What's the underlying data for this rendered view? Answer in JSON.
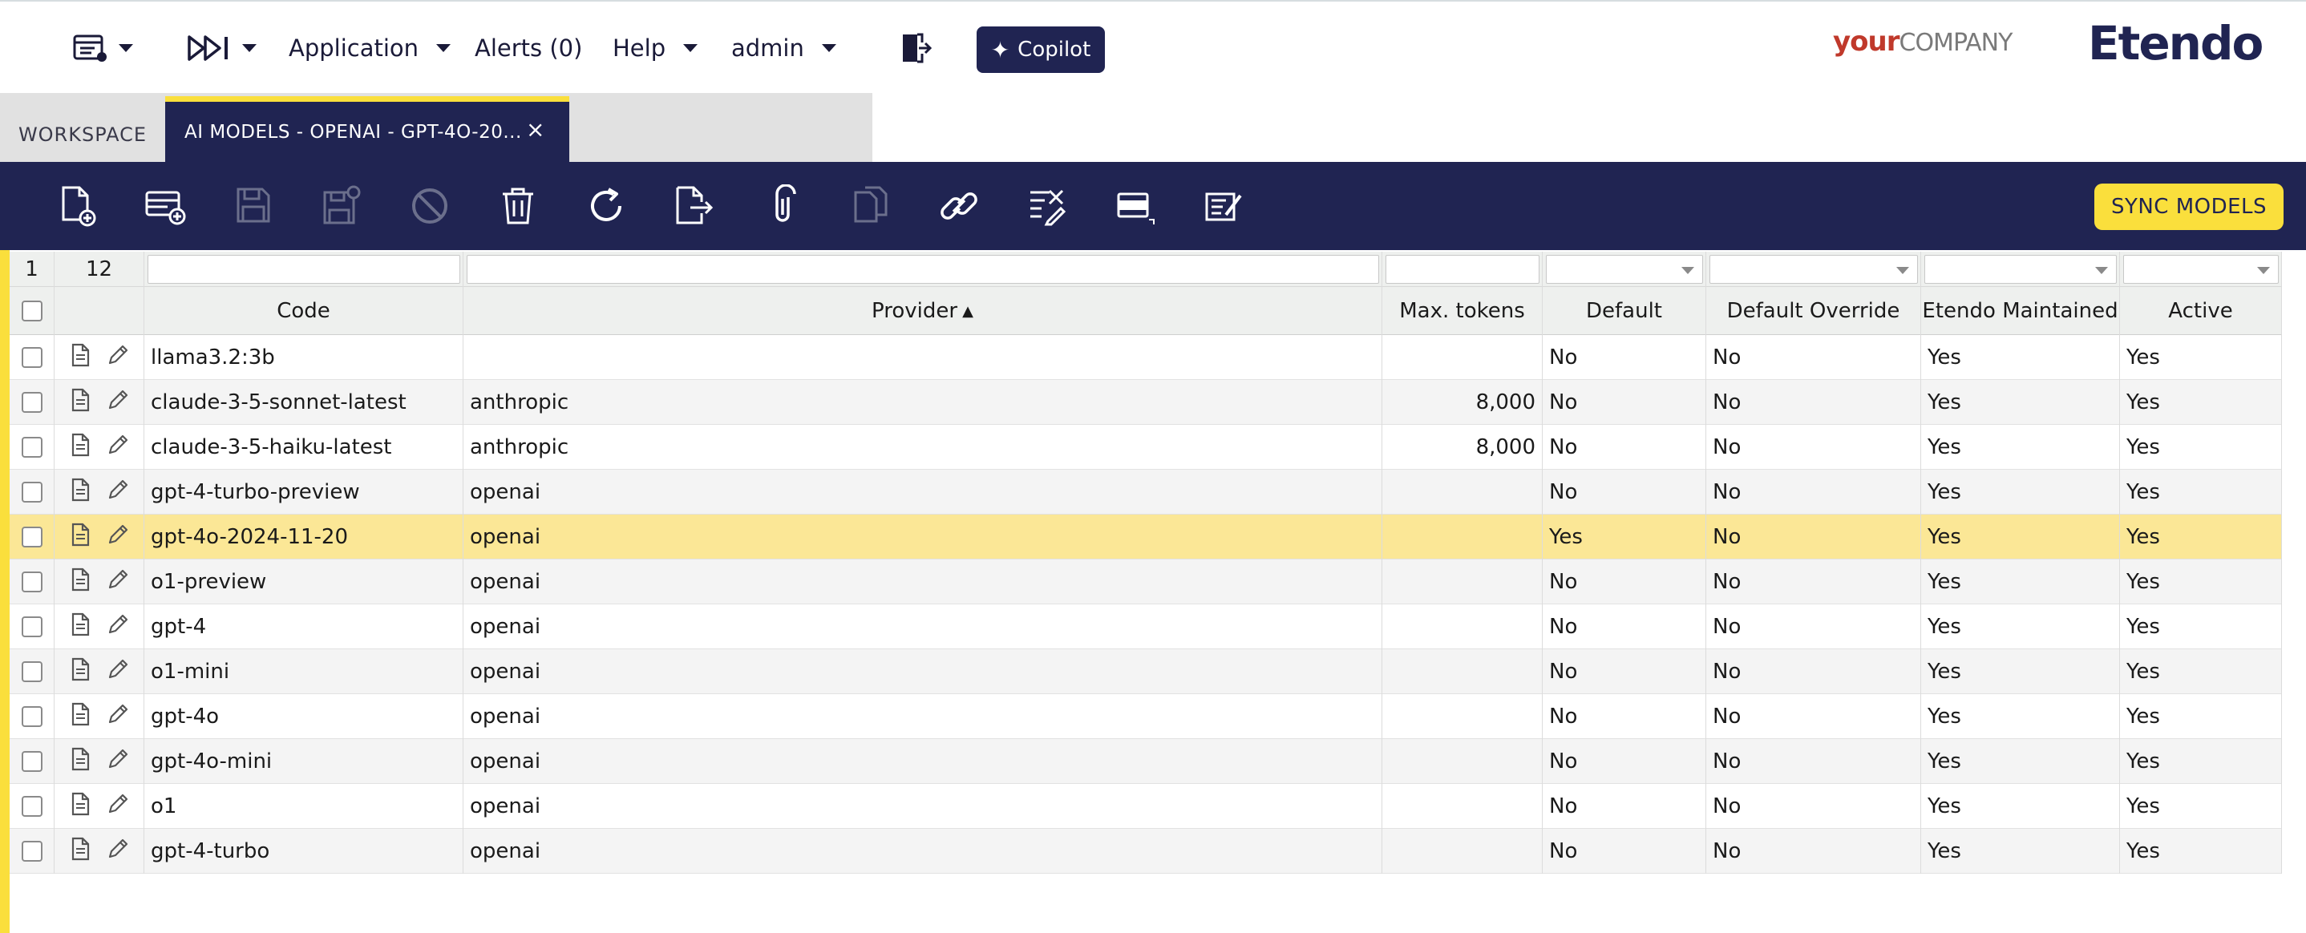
{
  "topbar": {
    "menus": [
      {
        "name": "application",
        "label": "Application"
      },
      {
        "name": "alerts",
        "label": "Alerts (0)"
      },
      {
        "name": "help",
        "label": "Help"
      },
      {
        "name": "user",
        "label": "admin"
      }
    ],
    "copilot_label": "Copilot",
    "company_logo": {
      "your": "your",
      "company": "COMPANY"
    },
    "brand_logo": "Etendo",
    "icons": [
      "form-menu-icon",
      "quick-launch-icon",
      "logout-icon",
      "copilot-sparkle-icon"
    ]
  },
  "tabs": {
    "workspace_label": "WORKSPACE",
    "active_label": "AI MODELS - OPENAI - GPT-4O-20...",
    "close_glyph": "×"
  },
  "toolbar": {
    "icons": [
      {
        "name": "new-document-icon",
        "enabled": true
      },
      {
        "name": "new-row-icon",
        "enabled": true
      },
      {
        "name": "save-icon",
        "enabled": false
      },
      {
        "name": "save-close-icon",
        "enabled": false
      },
      {
        "name": "undo-icon",
        "enabled": false
      },
      {
        "name": "delete-icon",
        "enabled": true
      },
      {
        "name": "refresh-icon",
        "enabled": true
      },
      {
        "name": "export-icon",
        "enabled": true
      },
      {
        "name": "attachment-icon",
        "enabled": true
      },
      {
        "name": "clone-icon",
        "enabled": false
      },
      {
        "name": "link-icon",
        "enabled": true
      },
      {
        "name": "audit-icon",
        "enabled": true
      },
      {
        "name": "grid-view-icon",
        "enabled": true
      },
      {
        "name": "process-icon",
        "enabled": true
      }
    ],
    "sync_label": "SYNC MODELS",
    "accent": "#fadf3c",
    "bar_color": "#202452"
  },
  "grid": {
    "selected_count": "1",
    "total_count": "12",
    "sort_indicator": "▲",
    "columns": [
      "Code",
      "Provider",
      "Max. tokens",
      "Default",
      "Default Override",
      "Etendo Maintained",
      "Active"
    ],
    "rows": [
      {
        "code": "llama3.2:3b",
        "provider": "",
        "max_tokens": "",
        "default": "No",
        "default_override": "No",
        "etendo_maintained": "Yes",
        "active": "Yes"
      },
      {
        "code": "claude-3-5-sonnet-latest",
        "provider": "anthropic",
        "max_tokens": "8,000",
        "default": "No",
        "default_override": "No",
        "etendo_maintained": "Yes",
        "active": "Yes"
      },
      {
        "code": "claude-3-5-haiku-latest",
        "provider": "anthropic",
        "max_tokens": "8,000",
        "default": "No",
        "default_override": "No",
        "etendo_maintained": "Yes",
        "active": "Yes"
      },
      {
        "code": "gpt-4-turbo-preview",
        "provider": "openai",
        "max_tokens": "",
        "default": "No",
        "default_override": "No",
        "etendo_maintained": "Yes",
        "active": "Yes"
      },
      {
        "code": "gpt-4o-2024-11-20",
        "provider": "openai",
        "max_tokens": "",
        "default": "Yes",
        "default_override": "No",
        "etendo_maintained": "Yes",
        "active": "Yes"
      },
      {
        "code": "o1-preview",
        "provider": "openai",
        "max_tokens": "",
        "default": "No",
        "default_override": "No",
        "etendo_maintained": "Yes",
        "active": "Yes"
      },
      {
        "code": "gpt-4",
        "provider": "openai",
        "max_tokens": "",
        "default": "No",
        "default_override": "No",
        "etendo_maintained": "Yes",
        "active": "Yes"
      },
      {
        "code": "o1-mini",
        "provider": "openai",
        "max_tokens": "",
        "default": "No",
        "default_override": "No",
        "etendo_maintained": "Yes",
        "active": "Yes"
      },
      {
        "code": "gpt-4o",
        "provider": "openai",
        "max_tokens": "",
        "default": "No",
        "default_override": "No",
        "etendo_maintained": "Yes",
        "active": "Yes"
      },
      {
        "code": "gpt-4o-mini",
        "provider": "openai",
        "max_tokens": "",
        "default": "No",
        "default_override": "No",
        "etendo_maintained": "Yes",
        "active": "Yes"
      },
      {
        "code": "o1",
        "provider": "openai",
        "max_tokens": "",
        "default": "No",
        "default_override": "No",
        "etendo_maintained": "Yes",
        "active": "Yes"
      },
      {
        "code": "gpt-4-turbo",
        "provider": "openai",
        "max_tokens": "",
        "default": "No",
        "default_override": "No",
        "etendo_maintained": "Yes",
        "active": "Yes"
      }
    ],
    "selected_row_color": "#fbe796"
  }
}
